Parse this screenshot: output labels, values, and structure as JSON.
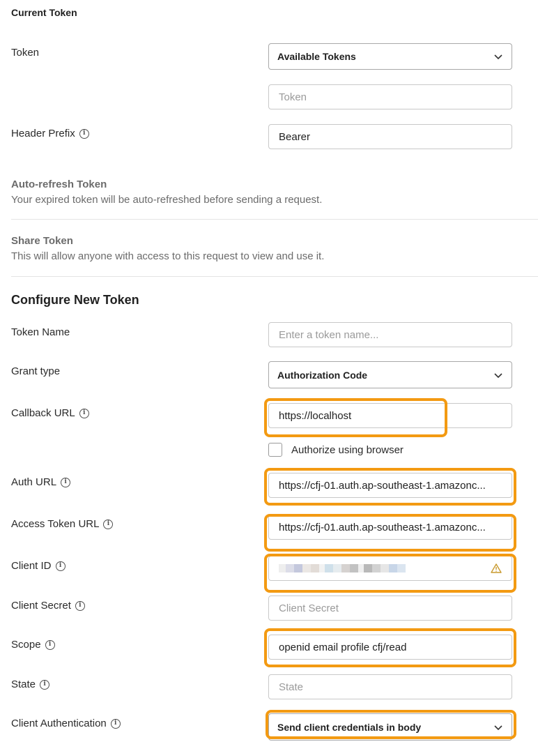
{
  "current_token": {
    "title": "Current Token",
    "token_label": "Token",
    "available_tokens": "Available Tokens",
    "token_placeholder": "Token",
    "header_prefix_label": "Header Prefix",
    "header_prefix_value": "Bearer"
  },
  "auto_refresh": {
    "title": "Auto-refresh Token",
    "desc": "Your expired token will be auto-refreshed before sending a request."
  },
  "share_token": {
    "title": "Share Token",
    "desc": "This will allow anyone with access to this request to view and use it."
  },
  "configure": {
    "title": "Configure New Token",
    "token_name_label": "Token Name",
    "token_name_placeholder": "Enter a token name...",
    "grant_type_label": "Grant type",
    "grant_type_value": "Authorization Code",
    "callback_url_label": "Callback URL",
    "callback_url_value": "https://localhost",
    "authorize_browser_label": "Authorize using browser",
    "auth_url_label": "Auth URL",
    "auth_url_value": "https://cfj-01.auth.ap-southeast-1.amazonc...",
    "access_token_url_label": "Access Token URL",
    "access_token_url_value": "https://cfj-01.auth.ap-southeast-1.amazonc...",
    "client_id_label": "Client ID",
    "client_secret_label": "Client Secret",
    "client_secret_placeholder": "Client Secret",
    "scope_label": "Scope",
    "scope_value": "openid email profile cfj/read",
    "state_label": "State",
    "state_placeholder": "State",
    "client_auth_label": "Client Authentication",
    "client_auth_value": "Send client credentials in body"
  },
  "colors": {
    "highlight": "#f39a12",
    "warning": "#c99a2e"
  },
  "icons": {
    "info": "info-icon",
    "chevron": "chevron-down-icon",
    "warning": "warning-icon"
  }
}
